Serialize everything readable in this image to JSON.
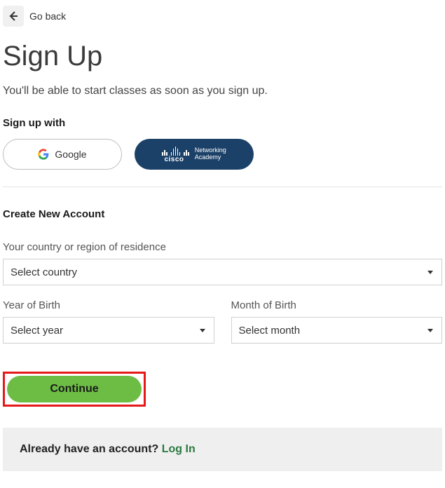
{
  "nav": {
    "goback": "Go back"
  },
  "title": "Sign Up",
  "subtitle": "You'll be able to start classes as soon as you sign up.",
  "signup_with_label": "Sign up with",
  "social": {
    "google": "Google",
    "cisco_brand": "cisco",
    "cisco_line1": "Networking",
    "cisco_line2": "Academy"
  },
  "create_section": "Create New Account",
  "fields": {
    "country_label": "Your country or region of residence",
    "country_value": "Select country",
    "year_label": "Year of Birth",
    "year_value": "Select year",
    "month_label": "Month of Birth",
    "month_value": "Select month"
  },
  "continue": "Continue",
  "already": {
    "text": "Already have an account? ",
    "link": "Log In"
  }
}
